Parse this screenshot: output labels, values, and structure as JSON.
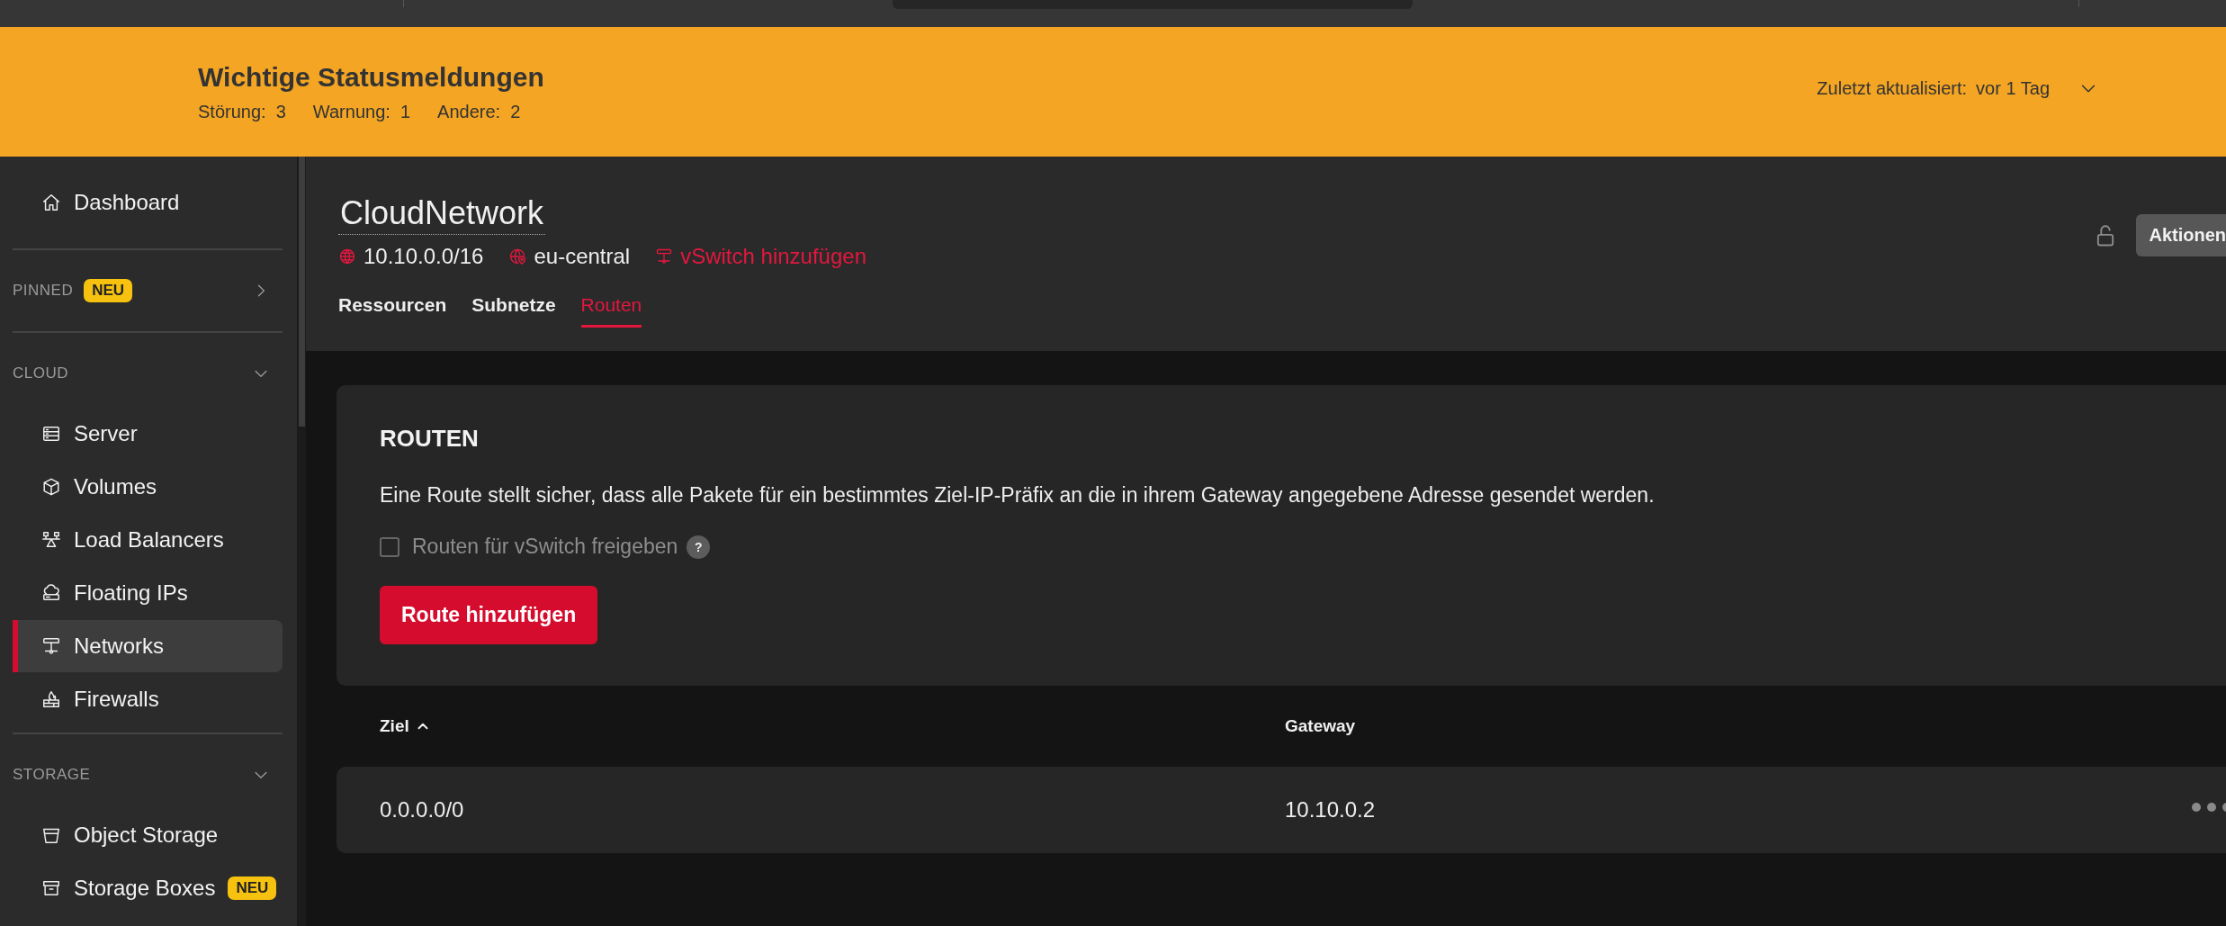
{
  "status_banner": {
    "title": "Wichtige Statusmeldungen",
    "counts": [
      {
        "label": "Störung:",
        "value": "3"
      },
      {
        "label": "Warnung:",
        "value": "1"
      },
      {
        "label": "Andere:",
        "value": "2"
      }
    ],
    "updated_label": "Zuletzt aktualisiert:",
    "updated_value": "vor 1 Tag",
    "expanded": false
  },
  "sidebar": [
    {
      "kind": "link",
      "label": "Dashboard",
      "selected": false
    },
    {
      "kind": "group",
      "label": "PINNED",
      "badge": "NEU",
      "expanded": false
    },
    {
      "kind": "group",
      "label": "CLOUD",
      "expanded": true,
      "children": [
        {
          "label": "Server",
          "selected": false
        },
        {
          "label": "Volumes",
          "selected": false
        },
        {
          "label": "Load Balancers",
          "selected": false
        },
        {
          "label": "Floating IPs",
          "selected": false
        },
        {
          "label": "Networks",
          "selected": true
        },
        {
          "label": "Firewalls",
          "selected": false
        }
      ]
    },
    {
      "kind": "group",
      "label": "STORAGE",
      "expanded": true,
      "children": [
        {
          "label": "Object Storage",
          "selected": false
        },
        {
          "label": "Storage Boxes",
          "badge": "NEU",
          "selected": false
        }
      ]
    }
  ],
  "header": {
    "title": "CloudNetwork",
    "ip_range": "10.10.0.0/16",
    "location": "eu-central",
    "vswitch_link": "vSwitch hinzufügen",
    "locked": false,
    "actions_button": "Aktionen",
    "tabs": [
      {
        "label": "Ressourcen",
        "selected": false
      },
      {
        "label": "Subnetze",
        "selected": false
      },
      {
        "label": "Routen",
        "selected": true
      }
    ]
  },
  "routes_card": {
    "title": "ROUTEN",
    "description": "Eine Route stellt sicher, dass alle Pakete für ein bestimmtes Ziel-IP-Präfix an die in ihrem Gateway angegebene Adresse gesendet werden.",
    "checkbox": {
      "label": "Routen für vSwitch freigeben",
      "checked": false,
      "help": "?"
    },
    "add_button": "Route hinzufügen"
  },
  "table": {
    "columns": [
      {
        "label": "Ziel",
        "sorted": true,
        "ascending": true
      },
      {
        "label": "Gateway",
        "sorted": false
      }
    ],
    "rows": [
      {
        "cells": [
          "0.0.0.0/0",
          "10.10.0.2"
        ]
      }
    ]
  }
}
